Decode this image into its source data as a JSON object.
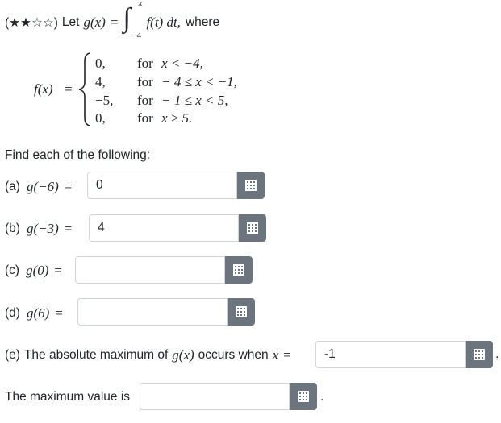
{
  "problem": {
    "stars": "(★★☆☆)",
    "intro_let": "Let",
    "g_of_x": "g(x)",
    "equals": "=",
    "integral_upper": "x",
    "integral_lower": "−4",
    "integrand": "f(t) dt,",
    "where": "where",
    "f_of_x": "f(x)",
    "cases": [
      {
        "value": "0,",
        "word": "for",
        "cond": "x < −4,"
      },
      {
        "value": "4,",
        "word": "for",
        "cond": "− 4 ≤ x < −1,"
      },
      {
        "value": "−5,",
        "word": "for",
        "cond": "− 1 ≤ x < 5,"
      },
      {
        "value": "0,",
        "word": "for",
        "cond": "x ≥ 5."
      }
    ],
    "find_text": "Find each of the following:"
  },
  "questions": {
    "a": {
      "label": "(a)",
      "expr": "g(−6)",
      "eq": "=",
      "value": "0"
    },
    "b": {
      "label": "(b)",
      "expr": "g(−3)",
      "eq": "=",
      "value": "4"
    },
    "c": {
      "label": "(c)",
      "expr": "g(0)",
      "eq": "=",
      "value": ""
    },
    "d": {
      "label": "(d)",
      "expr": "g(6)",
      "eq": "=",
      "value": ""
    },
    "e": {
      "label": "(e)",
      "text": "The absolute maximum of",
      "expr": "g(x)",
      "occurs": "occurs when",
      "var": "x",
      "eq": "=",
      "value": "-1"
    },
    "max": {
      "text": "The maximum value is",
      "value": ""
    }
  },
  "period": ".",
  "icons": {
    "palette": "equation-editor-grid-icon"
  }
}
